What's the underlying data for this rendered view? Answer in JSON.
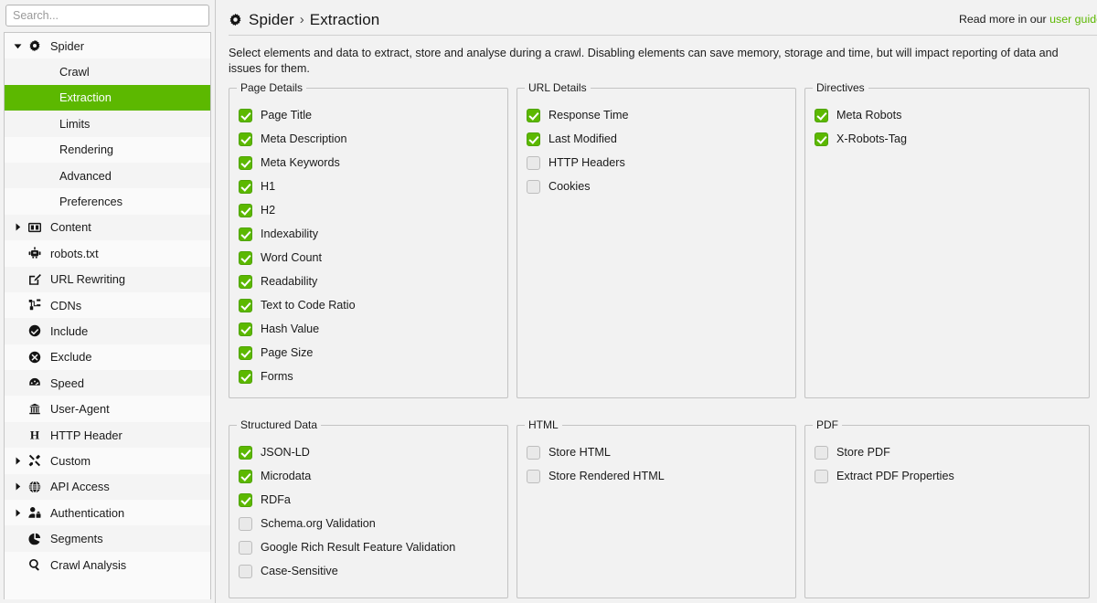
{
  "search": {
    "placeholder": "Search...",
    "value": ""
  },
  "sidebar": {
    "items": [
      {
        "label": "Spider",
        "icon": "gear-icon",
        "level": 0,
        "twisty": "down",
        "selected": false
      },
      {
        "label": "Crawl",
        "icon": "",
        "level": 1,
        "twisty": "",
        "selected": false
      },
      {
        "label": "Extraction",
        "icon": "",
        "level": 1,
        "twisty": "",
        "selected": true
      },
      {
        "label": "Limits",
        "icon": "",
        "level": 1,
        "twisty": "",
        "selected": false
      },
      {
        "label": "Rendering",
        "icon": "",
        "level": 1,
        "twisty": "",
        "selected": false
      },
      {
        "label": "Advanced",
        "icon": "",
        "level": 1,
        "twisty": "",
        "selected": false
      },
      {
        "label": "Preferences",
        "icon": "",
        "level": 1,
        "twisty": "",
        "selected": false
      },
      {
        "label": "Content",
        "icon": "columns-icon",
        "level": 0,
        "twisty": "right",
        "selected": false
      },
      {
        "label": "robots.txt",
        "icon": "robot-icon",
        "level": 0,
        "twisty": "",
        "selected": false
      },
      {
        "label": "URL Rewriting",
        "icon": "edit-square-icon",
        "level": 0,
        "twisty": "",
        "selected": false
      },
      {
        "label": "CDNs",
        "icon": "sitemap-icon",
        "level": 0,
        "twisty": "",
        "selected": false
      },
      {
        "label": "Include",
        "icon": "check-circle-icon",
        "level": 0,
        "twisty": "",
        "selected": false
      },
      {
        "label": "Exclude",
        "icon": "times-circle-icon",
        "level": 0,
        "twisty": "",
        "selected": false
      },
      {
        "label": "Speed",
        "icon": "gauge-icon",
        "level": 0,
        "twisty": "",
        "selected": false
      },
      {
        "label": "User-Agent",
        "icon": "user-agent-icon",
        "level": 0,
        "twisty": "",
        "selected": false
      },
      {
        "label": "HTTP Header",
        "icon": "letter-h-icon",
        "level": 0,
        "twisty": "",
        "selected": false
      },
      {
        "label": "Custom",
        "icon": "tools-icon",
        "level": 0,
        "twisty": "right",
        "selected": false
      },
      {
        "label": "API Access",
        "icon": "globe-icon",
        "level": 0,
        "twisty": "right",
        "selected": false
      },
      {
        "label": "Authentication",
        "icon": "user-lock-icon",
        "level": 0,
        "twisty": "right",
        "selected": false
      },
      {
        "label": "Segments",
        "icon": "pie-chart-icon",
        "level": 0,
        "twisty": "",
        "selected": false
      },
      {
        "label": "Crawl Analysis",
        "icon": "magnifier-icon",
        "level": 0,
        "twisty": "",
        "selected": false
      }
    ]
  },
  "header": {
    "breadcrumb_root": "Spider",
    "breadcrumb_sep": "›",
    "breadcrumb_current": "Extraction",
    "read_more_prefix": "Read more in our ",
    "read_more_link": "user guide",
    "gear_icon": "gear-icon"
  },
  "description": "Select elements and data to extract, store and analyse during a crawl. Disabling elements can save memory, storage and time, but will impact reporting of data and issues for them.",
  "groups": {
    "page_details": {
      "title": "Page Details",
      "items": [
        {
          "label": "Page Title",
          "checked": true
        },
        {
          "label": "Meta Description",
          "checked": true
        },
        {
          "label": "Meta Keywords",
          "checked": true
        },
        {
          "label": "H1",
          "checked": true
        },
        {
          "label": "H2",
          "checked": true
        },
        {
          "label": "Indexability",
          "checked": true
        },
        {
          "label": "Word Count",
          "checked": true
        },
        {
          "label": "Readability",
          "checked": true
        },
        {
          "label": "Text to Code Ratio",
          "checked": true
        },
        {
          "label": "Hash Value",
          "checked": true
        },
        {
          "label": "Page Size",
          "checked": true
        },
        {
          "label": "Forms",
          "checked": true
        }
      ]
    },
    "url_details": {
      "title": "URL Details",
      "items": [
        {
          "label": "Response Time",
          "checked": true
        },
        {
          "label": "Last Modified",
          "checked": true
        },
        {
          "label": "HTTP Headers",
          "checked": false
        },
        {
          "label": "Cookies",
          "checked": false
        }
      ]
    },
    "directives": {
      "title": "Directives",
      "items": [
        {
          "label": "Meta Robots",
          "checked": true
        },
        {
          "label": "X-Robots-Tag",
          "checked": true
        }
      ]
    },
    "structured_data": {
      "title": "Structured Data",
      "items": [
        {
          "label": "JSON-LD",
          "checked": true
        },
        {
          "label": "Microdata",
          "checked": true
        },
        {
          "label": "RDFa",
          "checked": true
        },
        {
          "label": "Schema.org Validation",
          "checked": false
        },
        {
          "label": "Google Rich Result Feature Validation",
          "checked": false
        },
        {
          "label": "Case-Sensitive",
          "checked": false
        }
      ]
    },
    "html": {
      "title": "HTML",
      "items": [
        {
          "label": "Store HTML",
          "checked": false
        },
        {
          "label": "Store Rendered HTML",
          "checked": false
        }
      ]
    },
    "pdf": {
      "title": "PDF",
      "items": [
        {
          "label": "Store PDF",
          "checked": false
        },
        {
          "label": "Extract PDF Properties",
          "checked": false
        }
      ]
    }
  },
  "colors": {
    "accent_green": "#5cb800",
    "window_bg": "#f2f2f2",
    "panel_border": "#c3c3c3",
    "text": "#1a1a1a"
  }
}
